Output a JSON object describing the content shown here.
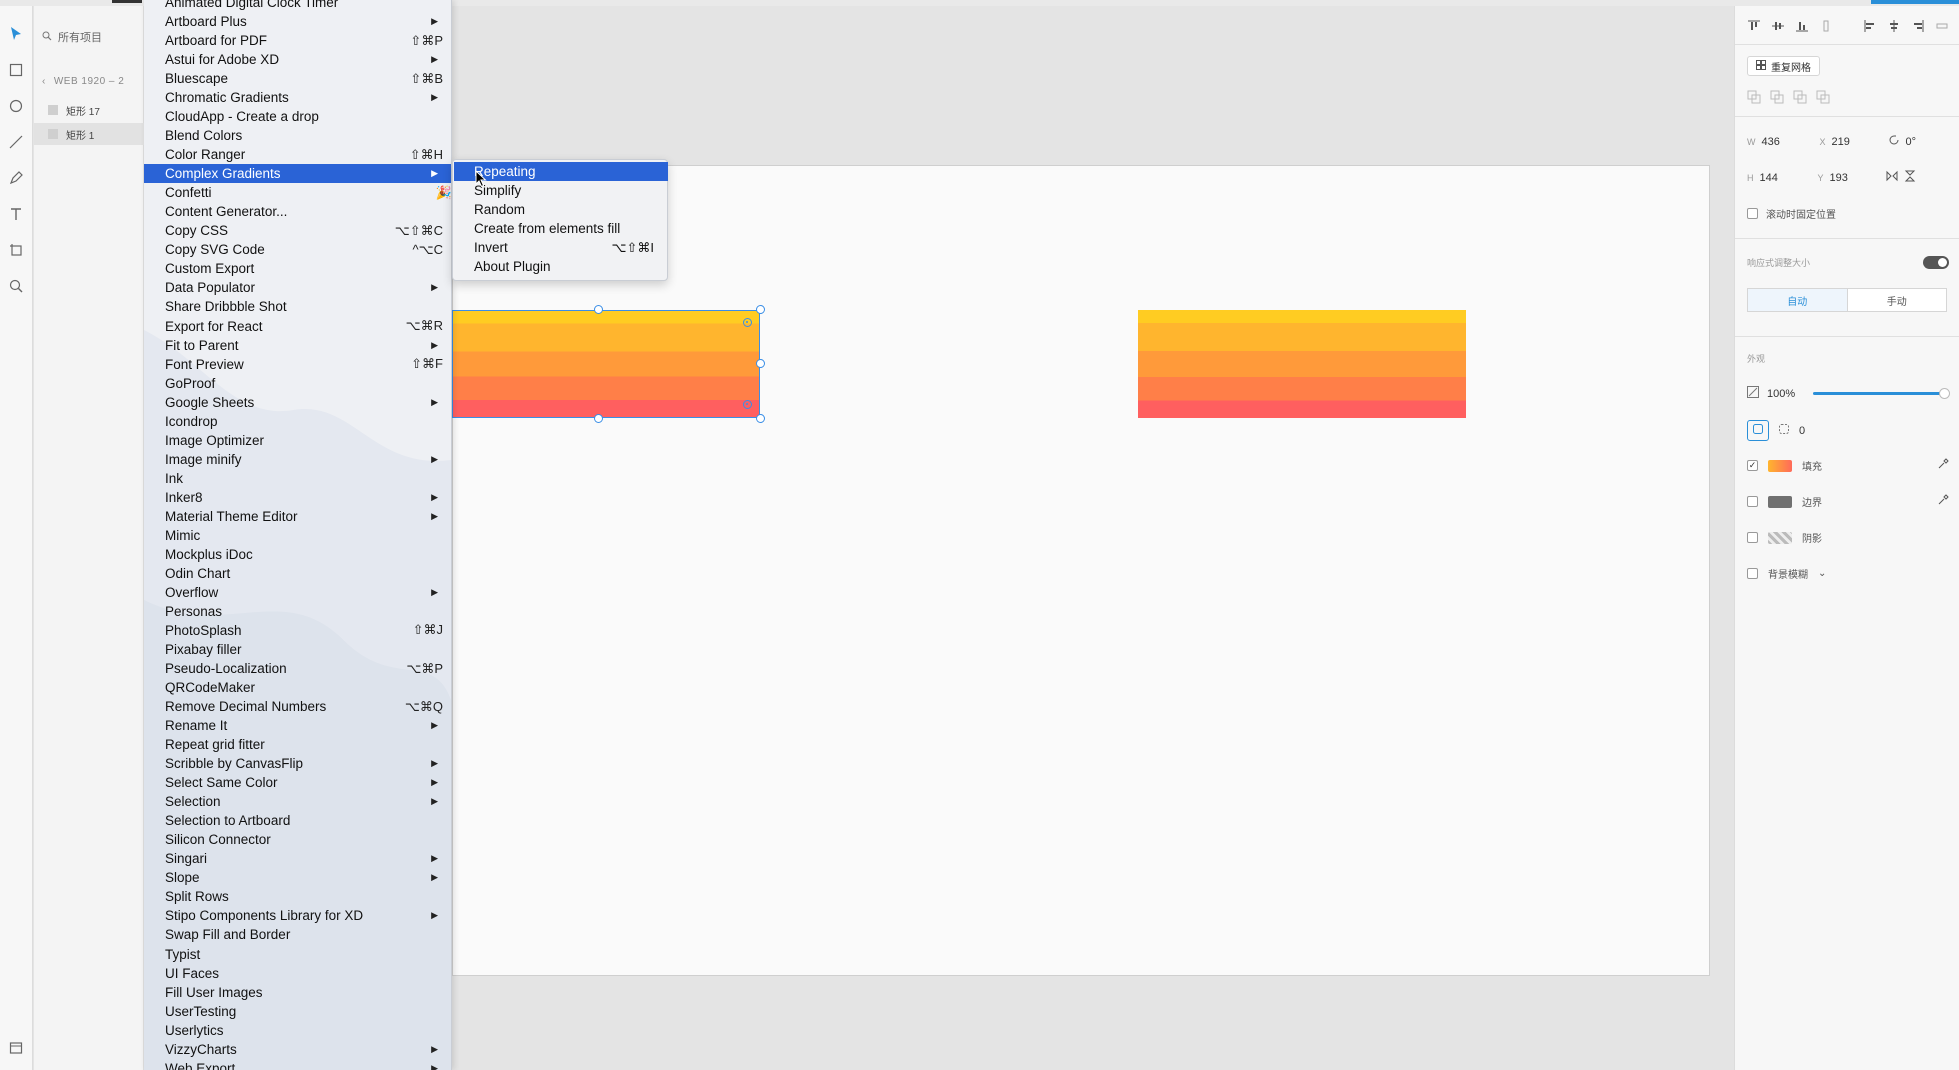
{
  "layers": {
    "search_placeholder": "所有项目",
    "breadcrumb": "WEB 1920 – 2",
    "items": [
      {
        "label": "矩形 17"
      },
      {
        "label": "矩形 1"
      }
    ]
  },
  "menu": {
    "items": [
      {
        "label": "Animated Digital Clock Timer",
        "shortcut": "",
        "submenu": false
      },
      {
        "label": "Artboard Plus",
        "shortcut": "",
        "submenu": true
      },
      {
        "label": "Artboard for PDF",
        "shortcut": "⇧⌘P",
        "submenu": false
      },
      {
        "label": "Astui for Adobe XD",
        "shortcut": "",
        "submenu": true
      },
      {
        "label": "Bluescape",
        "shortcut": "⇧⌘B",
        "submenu": false
      },
      {
        "label": "Chromatic Gradients",
        "shortcut": "",
        "submenu": true
      },
      {
        "label": "CloudApp - Create a drop",
        "shortcut": "",
        "submenu": false
      },
      {
        "label": "Blend Colors",
        "shortcut": "",
        "submenu": false
      },
      {
        "label": "Color Ranger",
        "shortcut": "⇧⌘H",
        "submenu": false
      },
      {
        "label": "Complex Gradients",
        "shortcut": "",
        "submenu": true,
        "active": true
      },
      {
        "label": "Confetti",
        "shortcut": "",
        "submenu": false,
        "emoji": "🎉"
      },
      {
        "label": "Content Generator...",
        "shortcut": "",
        "submenu": false
      },
      {
        "label": "Copy CSS",
        "shortcut": "⌥⇧⌘C",
        "submenu": false
      },
      {
        "label": "Copy SVG Code",
        "shortcut": "^⌥C",
        "submenu": false
      },
      {
        "label": "Custom Export",
        "shortcut": "",
        "submenu": false
      },
      {
        "label": "Data Populator",
        "shortcut": "",
        "submenu": true
      },
      {
        "label": "Share Dribbble Shot",
        "shortcut": "",
        "submenu": false
      },
      {
        "label": "Export for React",
        "shortcut": "⌥⌘R",
        "submenu": false
      },
      {
        "label": "Fit to Parent",
        "shortcut": "",
        "submenu": true
      },
      {
        "label": "Font Preview",
        "shortcut": "⇧⌘F",
        "submenu": false
      },
      {
        "label": "GoProof",
        "shortcut": "",
        "submenu": false
      },
      {
        "label": "Google Sheets",
        "shortcut": "",
        "submenu": true
      },
      {
        "label": "Icondrop",
        "shortcut": "",
        "submenu": false
      },
      {
        "label": "Image Optimizer",
        "shortcut": "",
        "submenu": false
      },
      {
        "label": "Image minify",
        "shortcut": "",
        "submenu": true
      },
      {
        "label": "Ink",
        "shortcut": "",
        "submenu": false
      },
      {
        "label": "Inker8",
        "shortcut": "",
        "submenu": true
      },
      {
        "label": "Material Theme Editor",
        "shortcut": "",
        "submenu": true
      },
      {
        "label": "Mimic",
        "shortcut": "",
        "submenu": false
      },
      {
        "label": "Mockplus iDoc",
        "shortcut": "",
        "submenu": false
      },
      {
        "label": "Odin Chart",
        "shortcut": "",
        "submenu": false
      },
      {
        "label": "Overflow",
        "shortcut": "",
        "submenu": true
      },
      {
        "label": "Personas",
        "shortcut": "",
        "submenu": false
      },
      {
        "label": "PhotoSplash",
        "shortcut": "⇧⌘J",
        "submenu": false
      },
      {
        "label": "Pixabay filler",
        "shortcut": "",
        "submenu": false
      },
      {
        "label": "Pseudo-Localization",
        "shortcut": "⌥⌘P",
        "submenu": false
      },
      {
        "label": "QRCodeMaker",
        "shortcut": "",
        "submenu": false
      },
      {
        "label": "Remove Decimal Numbers",
        "shortcut": "⌥⌘Q",
        "submenu": false
      },
      {
        "label": "Rename It",
        "shortcut": "",
        "submenu": true
      },
      {
        "label": "Repeat grid fitter",
        "shortcut": "",
        "submenu": false
      },
      {
        "label": "Scribble by CanvasFlip",
        "shortcut": "",
        "submenu": true
      },
      {
        "label": "Select Same Color",
        "shortcut": "",
        "submenu": true
      },
      {
        "label": "Selection",
        "shortcut": "",
        "submenu": true
      },
      {
        "label": "Selection to Artboard",
        "shortcut": "",
        "submenu": false
      },
      {
        "label": "Silicon Connector",
        "shortcut": "",
        "submenu": false
      },
      {
        "label": "Singari",
        "shortcut": "",
        "submenu": true
      },
      {
        "label": "Slope",
        "shortcut": "",
        "submenu": true
      },
      {
        "label": "Split Rows",
        "shortcut": "",
        "submenu": false
      },
      {
        "label": "Stipo Components Library for XD",
        "shortcut": "",
        "submenu": true
      },
      {
        "label": "Swap Fill and Border",
        "shortcut": "",
        "submenu": false
      },
      {
        "label": "Typist",
        "shortcut": "",
        "submenu": false
      },
      {
        "label": "UI Faces",
        "shortcut": "",
        "submenu": false
      },
      {
        "label": "Fill User Images",
        "shortcut": "",
        "submenu": false
      },
      {
        "label": "UserTesting",
        "shortcut": "",
        "submenu": false
      },
      {
        "label": "Userlytics",
        "shortcut": "",
        "submenu": false
      },
      {
        "label": "VizzyCharts",
        "shortcut": "",
        "submenu": true
      },
      {
        "label": "Web Export",
        "shortcut": "",
        "submenu": true
      }
    ]
  },
  "submenu": {
    "items": [
      {
        "label": "Repeating",
        "shortcut": "",
        "active": true
      },
      {
        "label": "Simplify",
        "shortcut": ""
      },
      {
        "label": "Random",
        "shortcut": ""
      },
      {
        "label": "Create from elements fill",
        "shortcut": ""
      },
      {
        "label": "Invert",
        "shortcut": "⌥⇧⌘I"
      },
      {
        "label": "About Plugin",
        "shortcut": ""
      }
    ]
  },
  "props": {
    "repeat_grid": "重复网格",
    "w_label": "W",
    "w_value": "436",
    "x_label": "X",
    "x_value": "219",
    "rotation": "0°",
    "h_label": "H",
    "h_value": "144",
    "y_label": "Y",
    "y_value": "193",
    "fix_position": "滚动时固定位置",
    "responsive_resize": "响应式调整大小",
    "auto": "自动",
    "manual": "手动",
    "appearance": "外观",
    "opacity": "100%",
    "corner_radius": "0",
    "fill": "填充",
    "border": "边界",
    "shadow": "阴影",
    "bg_blur": "背景模糊"
  },
  "colors": {
    "accent": "#2a8fd8",
    "menu_highlight": "#2a63d6",
    "gradient": [
      "#ffcc22",
      "#ffb52e",
      "#ff9a3a",
      "#ff7f48",
      "#ff5f5f"
    ]
  }
}
